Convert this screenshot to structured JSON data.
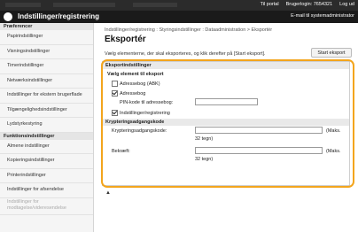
{
  "topbar": {
    "portal_link": "Til portal",
    "user_login": "Brugerlogin: 7654321",
    "logout": "Log ud"
  },
  "header": {
    "title": "Indstillinger/registrering",
    "mail_link": "E-mail til systemadministrator"
  },
  "sidebar": {
    "preferences_heading": "Præferencer",
    "preference_items": [
      "Papirindstillinger",
      "Visningsindstillinger",
      "Timerindstillinger",
      "Netværksindstillinger",
      "Indstillinger for ekstern brugerflade",
      "Tilgængelighedsindstillinger",
      "Lydstyrkestyring"
    ],
    "functions_heading": "Funktionsindstillinger",
    "function_items": [
      "Almene indstillinger",
      "Kopieringsindstillinger",
      "Printerindstillinger",
      "Indstillinger for afsendelse",
      "Indstillinger for modtagelse/videresendelse"
    ]
  },
  "main": {
    "breadcrumb": "Indstillinger/registrering : Styringsindstillinger : Dataadministration > Eksportér",
    "title": "Eksportér",
    "hint": "Vælg elementerne, der skal eksporteres, og klik derefter på [Start eksport].",
    "start_button": "Start eksport",
    "export_settings": {
      "heading": "Eksportindstillinger",
      "subheading": "Vælg element til eksport",
      "items": [
        {
          "label": "Adressebog (ABK)",
          "checked": false
        },
        {
          "label": "Adressebog",
          "checked": true
        },
        {
          "label": "Indstillinger/registrering",
          "checked": true
        }
      ],
      "pin_label": "PIN-kode til adressebog:",
      "pin_value": ""
    },
    "encryption": {
      "heading": "Krypteringsadgangskode",
      "password_label": "Krypteringsadgangskode:",
      "password_value": "",
      "max_note_prefix": "(Maks.",
      "max_note_suffix": "32 tegn)",
      "confirm_label": "Bekræft:",
      "confirm_value": ""
    }
  }
}
